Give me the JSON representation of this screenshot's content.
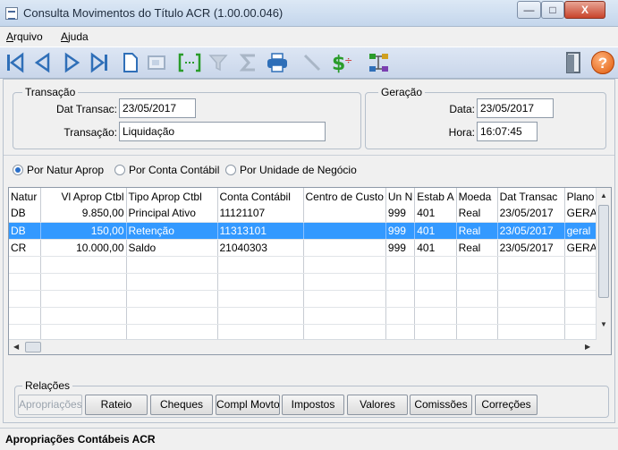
{
  "window": {
    "title": "Consulta Movimentos do Título ACR (1.00.00.046)",
    "minimize": "—",
    "maximize": "□",
    "close": "X"
  },
  "menu": [
    {
      "label": "Arquivo",
      "accel": "A",
      "rest": "rquivo"
    },
    {
      "label": "Ajuda",
      "accel": "A",
      "rest": "juda"
    }
  ],
  "toolbar": {
    "first": "◀",
    "prev": "◀",
    "next": "▶",
    "last": "▶",
    "icons": [
      "first-record-icon",
      "previous-record-icon",
      "next-record-icon",
      "last-record-icon",
      "document-icon",
      "zoom-icon",
      "bracket-range-icon",
      "filter-icon",
      "sum-icon",
      "print-icon",
      "line-icon",
      "currency-icon",
      "tree-icon",
      "exit-door-icon",
      "help-icon"
    ],
    "help_label": "?"
  },
  "transacao": {
    "legend": "Transação",
    "dat_transac_label": "Dat Transac:",
    "dat_transac_value": "23/05/2017",
    "transacao_label": "Transação:",
    "transacao_value": "Liquidação"
  },
  "geracao": {
    "legend": "Geração",
    "data_label": "Data:",
    "data_value": "23/05/2017",
    "hora_label": "Hora:",
    "hora_value": "16:07:45"
  },
  "radios": [
    {
      "label": "Por Natur Aprop",
      "checked": true
    },
    {
      "label": "Por Conta Contábil",
      "checked": false
    },
    {
      "label": "Por Unidade de Negócio",
      "checked": false
    }
  ],
  "grid": {
    "columns": [
      "Natur",
      "Vl Aprop Ctbl",
      "Tipo Aprop Ctbl",
      "Conta Contábil",
      "Centro de Custo",
      "Un N",
      "Estab A",
      "Moeda",
      "Dat Transac",
      "Plano"
    ],
    "rows": [
      [
        "DB",
        "9.850,00",
        "Principal Ativo",
        "11121107",
        "",
        "999",
        "401",
        "Real",
        "23/05/2017",
        "GERA"
      ],
      [
        "DB",
        "150,00",
        "Retenção",
        "11313101",
        "",
        "999",
        "401",
        "Real",
        "23/05/2017",
        "geral"
      ],
      [
        "CR",
        "10.000,00",
        "Saldo",
        "21040303",
        "",
        "999",
        "401",
        "Real",
        "23/05/2017",
        "GERA"
      ]
    ],
    "selected_row": 1
  },
  "relacoes": {
    "legend": "Relações",
    "buttons": [
      "Apropriações",
      "Rateio",
      "Cheques",
      "Compl Movto",
      "Impostos",
      "Valores",
      "Comissões",
      "Correções"
    ],
    "disabled": [
      true,
      false,
      false,
      false,
      false,
      false,
      false,
      false
    ]
  },
  "status": {
    "text": "Apropriações Contábeis ACR"
  }
}
